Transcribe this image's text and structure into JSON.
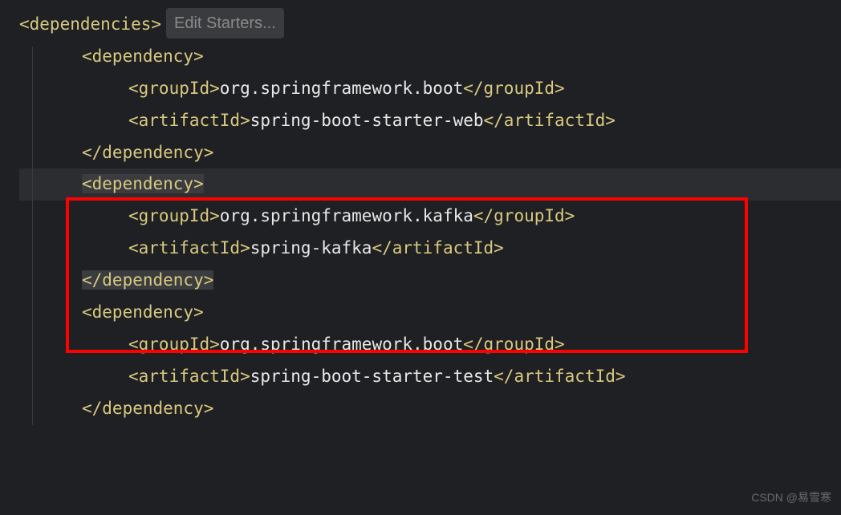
{
  "editor": {
    "hint_label": "Edit Starters...",
    "tags": {
      "dependencies_open": "<dependencies>",
      "dependency_open": "<dependency>",
      "dependency_close": "</dependency>",
      "groupId_open": "<groupId>",
      "groupId_close": "</groupId>",
      "artifactId_open": "<artifactId>",
      "artifactId_close": "</artifactId>"
    },
    "deps": [
      {
        "groupId": "org.springframework.boot",
        "artifactId": "spring-boot-starter-web"
      },
      {
        "groupId": "org.springframework.kafka",
        "artifactId": "spring-kafka"
      },
      {
        "groupId": "org.springframework.boot",
        "artifactId": "spring-boot-starter-test"
      }
    ]
  },
  "watermark": "CSDN @易雪寒"
}
